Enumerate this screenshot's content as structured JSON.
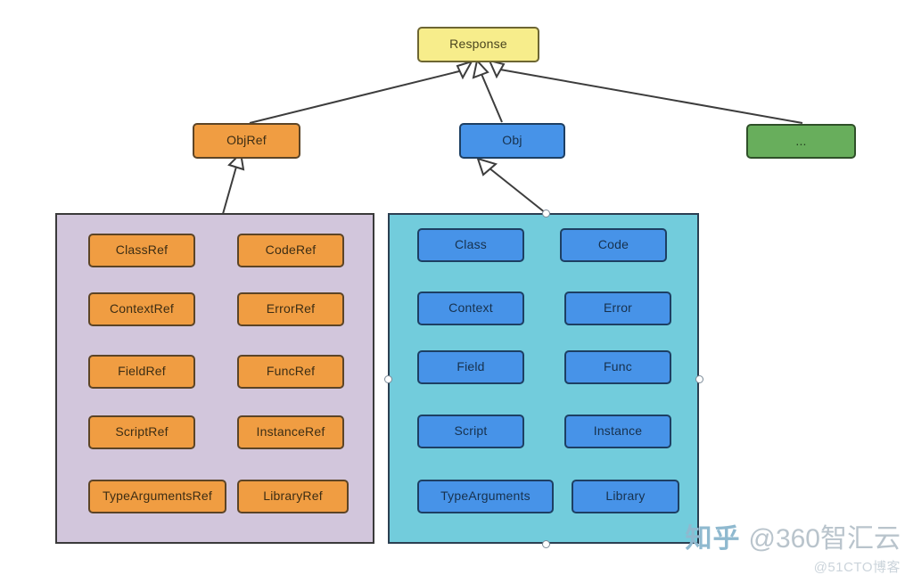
{
  "diagram": {
    "title_node": {
      "label": "Response",
      "color": "#f7ed8b"
    },
    "mid_nodes": [
      {
        "label": "ObjRef",
        "color": "#f09d42"
      },
      {
        "label": "Obj",
        "color": "#4793e8"
      },
      {
        "label": "...",
        "color": "#68ae5c"
      }
    ],
    "groups": [
      {
        "name": "objref-group",
        "color": "#d2c6dc",
        "items": [
          "ClassRef",
          "CodeRef",
          "ContextRef",
          "ErrorRef",
          "FieldRef",
          "FuncRef",
          "ScriptRef",
          "InstanceRef",
          "TypeArgumentsRef",
          "LibraryRef"
        ]
      },
      {
        "name": "obj-group",
        "color": "#72ccdc",
        "selected": true,
        "items": [
          "Class",
          "Code",
          "Context",
          "Error",
          "Field",
          "Func",
          "Script",
          "Instance",
          "TypeArguments",
          "Library"
        ]
      }
    ],
    "edges": [
      {
        "from": "ObjRef",
        "to": "Response",
        "kind": "inheritance"
      },
      {
        "from": "Obj",
        "to": "Response",
        "kind": "inheritance"
      },
      {
        "from": "...",
        "to": "Response",
        "kind": "inheritance"
      },
      {
        "from": "objref-group",
        "to": "ObjRef",
        "kind": "inheritance"
      },
      {
        "from": "obj-group",
        "to": "Obj",
        "kind": "inheritance"
      }
    ]
  },
  "watermark": {
    "logo": "知乎",
    "account": "@360智汇云",
    "sub_account": "@51CTO博客"
  }
}
